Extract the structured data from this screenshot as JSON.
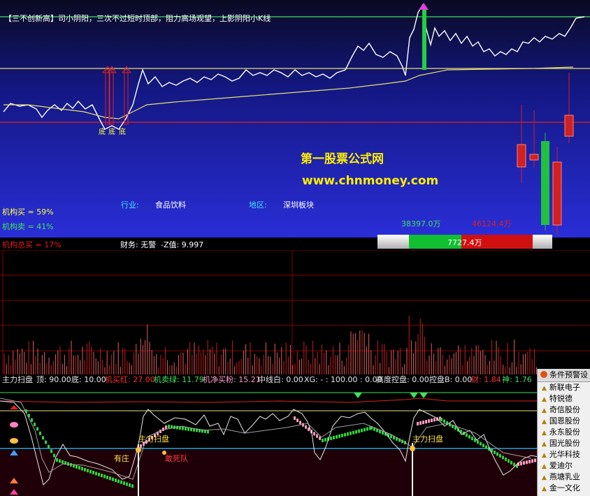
{
  "header_text": "【三不创新高】司小阴阳，三次不过短时顶部，阻力高场观望，上影阴阳小K线",
  "watermark": {
    "title": "第一股票公式网",
    "url": "www.chnmoney.com"
  },
  "price_panel": {
    "labels": {
      "di1": "底",
      "di2": "底",
      "di3": "底"
    },
    "industry_label": "行业:",
    "industry_value": "食品饮料",
    "region_label": "地区:",
    "region_value": "深圳板块",
    "inst_buy": "机构买 = 59%",
    "inst_sell": "机构卖 = 41%",
    "inst_total_buy": "机构总买 = 17%",
    "finance": "财务: 无警",
    "zvalue": "-Z值: 9.997",
    "money_green": "38397.0万",
    "money_red": "46124.4万",
    "money_net": "7727.4万"
  },
  "indicator_header": {
    "name": "主力扫盘",
    "top": "顶: 90.00",
    "bottom": "底: 10.00",
    "inst_buy_red": "机买红: 27.00",
    "inst_sell_green": "机卖绿: 11.79",
    "inst_net_pink": "机净买粉: 15.21",
    "mid_white": "中线白: 0.00",
    "xg": "XG: - : 100.00 : 0.00",
    "control": "高度控盘: 0.00",
    "control_b": "控盘B: 0.00",
    "cai": "财: 1.84",
    "shen": "神: 1.76"
  },
  "indicator_labels": {
    "zhuli1": "主力扫盘",
    "zhuli2": "主力扫盘",
    "youzhuang": "有庄",
    "ganshidui": "敢死队"
  },
  "alert_panel": {
    "title": "条件预警设",
    "items": [
      "新联电子",
      "特锐德",
      "奇信股份",
      "国恩股份",
      "永东股份",
      "国光股份",
      "光华科技",
      "爱迪尔",
      "燕塘乳业",
      "金一文化"
    ]
  },
  "colors": {
    "price_line": "#ffffff",
    "ma_line": "#e8e070",
    "red_line": "#e02020",
    "yellow_line": "#e8e070",
    "green_line": "#40e060",
    "up_bar": "#d02020",
    "down_bar": "#20c040"
  }
}
